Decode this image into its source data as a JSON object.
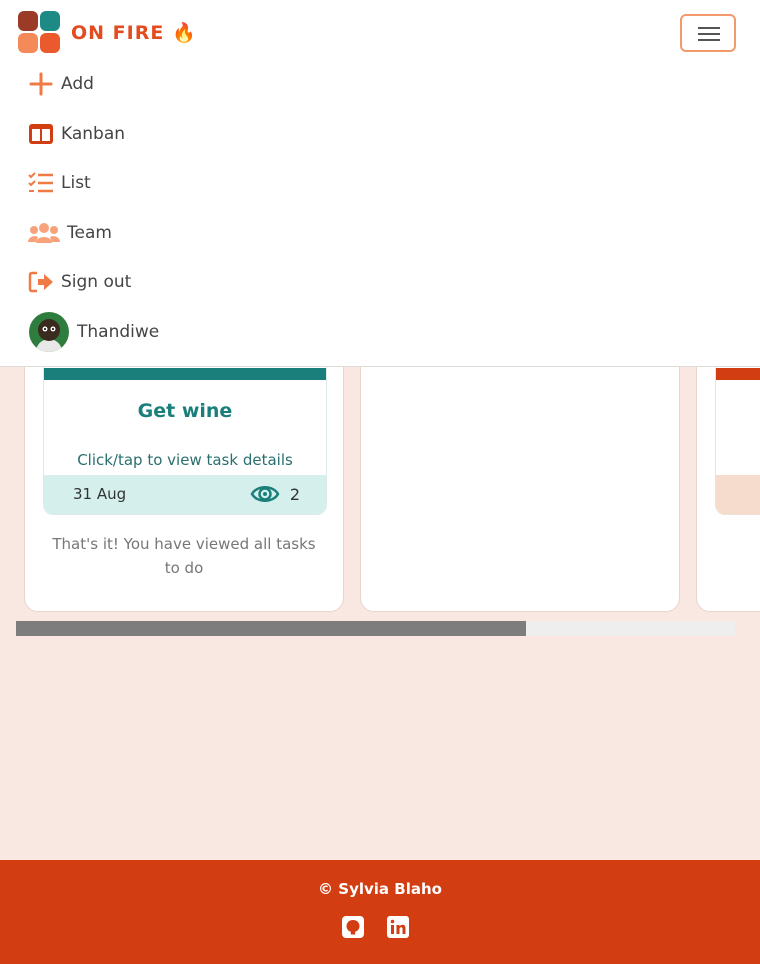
{
  "header": {
    "brand": "ON FIRE 🔥",
    "logo_icon": "app-logo-grid",
    "menu_icon": "hamburger-icon"
  },
  "nav": {
    "items": [
      {
        "label": "Add",
        "icon": "plus-icon"
      },
      {
        "label": "Kanban",
        "icon": "kanban-icon"
      },
      {
        "label": "List",
        "icon": "checklist-icon"
      },
      {
        "label": "Team",
        "icon": "users-icon"
      },
      {
        "label": "Sign out",
        "icon": "sign-out-icon"
      }
    ],
    "user": {
      "name": "Thandiwe",
      "icon": "avatar"
    }
  },
  "board": {
    "card": {
      "title": "Get wine",
      "hint": "Click/tap to view task details",
      "date": "31 Aug",
      "views": "2"
    },
    "done_message": "That's it! You have viewed all tasks to do",
    "scroll_position": 0.71
  },
  "footer": {
    "copyright": "© Sylvia Blaho",
    "links": [
      {
        "icon": "github-icon"
      },
      {
        "icon": "linkedin-icon"
      }
    ]
  },
  "colors": {
    "brand_orange": "#e24c1e",
    "teal": "#1a7f7b",
    "footer_red": "#d23e12",
    "page_bg": "#f8e8e1"
  }
}
